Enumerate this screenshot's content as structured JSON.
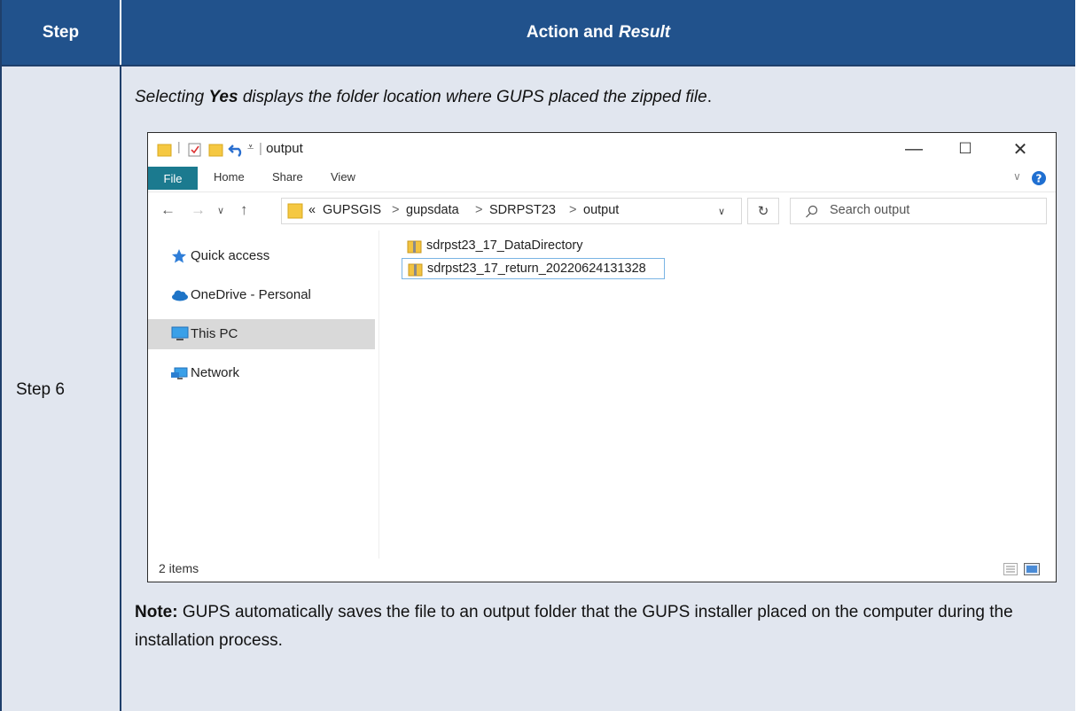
{
  "header": {
    "step": "Step",
    "action": "Action and",
    "result": "Result"
  },
  "row": {
    "step_label": "Step 6",
    "intro_pre": "Selecting ",
    "intro_yes": "Yes",
    "intro_post": " displays the folder location where GUPS placed the zipped file",
    "intro_end": ".",
    "note_label": "Note:",
    "note_text": " GUPS automatically saves the file to an output folder that the GUPS installer placed on the computer during the installation process."
  },
  "explorer": {
    "title": "output",
    "window_controls": {
      "minimize": "—",
      "maximize": "☐",
      "close": "✕"
    },
    "ribbon_tabs": [
      "File",
      "Home",
      "Share",
      "View"
    ],
    "breadcrumb": [
      "«",
      "GUPSGIS",
      ">",
      "gupsdata",
      ">",
      "SDRPST23",
      ">",
      "output"
    ],
    "search_placeholder": "Search output",
    "nav_items": [
      {
        "label": "Quick access",
        "icon": "star-icon"
      },
      {
        "label": "OneDrive - Personal",
        "icon": "cloud-icon"
      },
      {
        "label": "This PC",
        "icon": "monitor-icon",
        "selected": true
      },
      {
        "label": "Network",
        "icon": "network-icon"
      }
    ],
    "files": [
      {
        "name": "sdrpst23_17_DataDirectory",
        "icon": "zip-folder-icon"
      },
      {
        "name": "sdrpst23_17_return_20220624131328",
        "icon": "zip-folder-icon",
        "selected": true
      }
    ],
    "status_count": "2 items",
    "colors": {
      "file_tab": "#1b7a8f",
      "header": "#21528c",
      "cell_bg": "#e1e6ef"
    }
  }
}
